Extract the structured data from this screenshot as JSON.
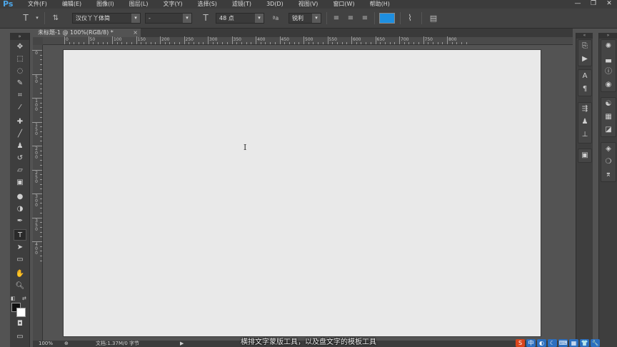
{
  "app": {
    "logo": "Ps"
  },
  "menu": [
    "文件(F)",
    "编辑(E)",
    "图像(I)",
    "图层(L)",
    "文字(Y)",
    "选择(S)",
    "滤镜(T)",
    "3D(D)",
    "视图(V)",
    "窗口(W)",
    "帮助(H)"
  ],
  "window_controls": [
    "—",
    "❐",
    "✕"
  ],
  "options_bar": {
    "font_family": "汉仪丫丫体简",
    "font_style": "-",
    "font_size": "48 点",
    "aa_label": "ªa",
    "antialias": "锐利",
    "text_color": "#1e8fe0"
  },
  "document": {
    "tab_title": "未标题-1 @ 100%(RGB/8) *",
    "close": "×"
  },
  "ruler_top": [
    "0",
    "50",
    "100",
    "150",
    "200",
    "250",
    "300",
    "350",
    "400",
    "450",
    "500",
    "550",
    "600",
    "650",
    "700",
    "750",
    "800"
  ],
  "ruler_left": [
    "0",
    "50",
    "100",
    "150",
    "200",
    "250",
    "300",
    "350",
    "400"
  ],
  "cursor_glyph": "I",
  "status": {
    "zoom": "100%",
    "doc_info": "文档:1.37M/0 字节",
    "arrow": "▶"
  },
  "subtitle": "横排文字蒙版工具，以及盘文字的模板工具",
  "tray": [
    "S",
    "中",
    "◐",
    "☾",
    "⌨",
    "▦",
    "👕",
    "🔧"
  ]
}
